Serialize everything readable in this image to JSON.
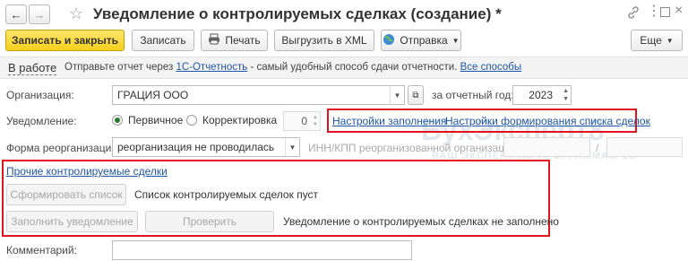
{
  "window": {
    "title": "Уведомление о контролируемых сделках (создание) *",
    "nav_back": "←",
    "nav_forward": "→",
    "favorite_icon": "star-outline-icon",
    "link_icon": "link-icon",
    "more_icon": "kebab-icon",
    "maximize_icon": "maximize-icon",
    "close_icon": "close-icon"
  },
  "toolbar": {
    "save_close": "Записать и закрыть",
    "save": "Записать",
    "print": "Печать",
    "export_xml": "Выгрузить в XML",
    "send": "Отправка",
    "more": "Еще"
  },
  "status_bar": {
    "status": "В работе",
    "text_before": "Отправьте отчет через",
    "service_link": "1С-Отчетность",
    "text_after": "- самый удобный способ сдачи отчетности.",
    "all_methods_link": "Все способы"
  },
  "org": {
    "label": "Организация:",
    "value": "ГРАЦИЯ ООО",
    "year_label": "за отчетный год:",
    "year_value": "2023"
  },
  "notice": {
    "label": "Уведомление:",
    "primary": "Первичное",
    "corrective": "Корректировка",
    "corr_number": "0",
    "settings_fill_link": "Настройки заполнения",
    "settings_list_link": "Настройки формирования списка сделок"
  },
  "reorg": {
    "label": "Форма реорганизации:",
    "value": "реорганизация не проводилась",
    "inn_label": "ИНН/КПП реорганизованной организации:",
    "slash": "/"
  },
  "other_deals": {
    "link": "Прочие контролируемые сделки",
    "form_list_button": "Сформировать список",
    "list_status": "Список контролируемых сделок пуст",
    "fill_button": "Заполнить уведомление",
    "check_button": "Проверить",
    "notice_status": "Уведомление о контролируемых сделках не заполнено"
  },
  "comment": {
    "label": "Комментарий:",
    "value": ""
  },
  "watermark": {
    "text": "БухЭксперт8",
    "subtext": "ВАШ ЭКСПЕРТ ПО ПРОГРАММАМ 1С"
  },
  "colors": {
    "highlight_red": "#e0141e",
    "primary_yellow": "#f5cf1d",
    "link_blue": "#1f56a6"
  }
}
